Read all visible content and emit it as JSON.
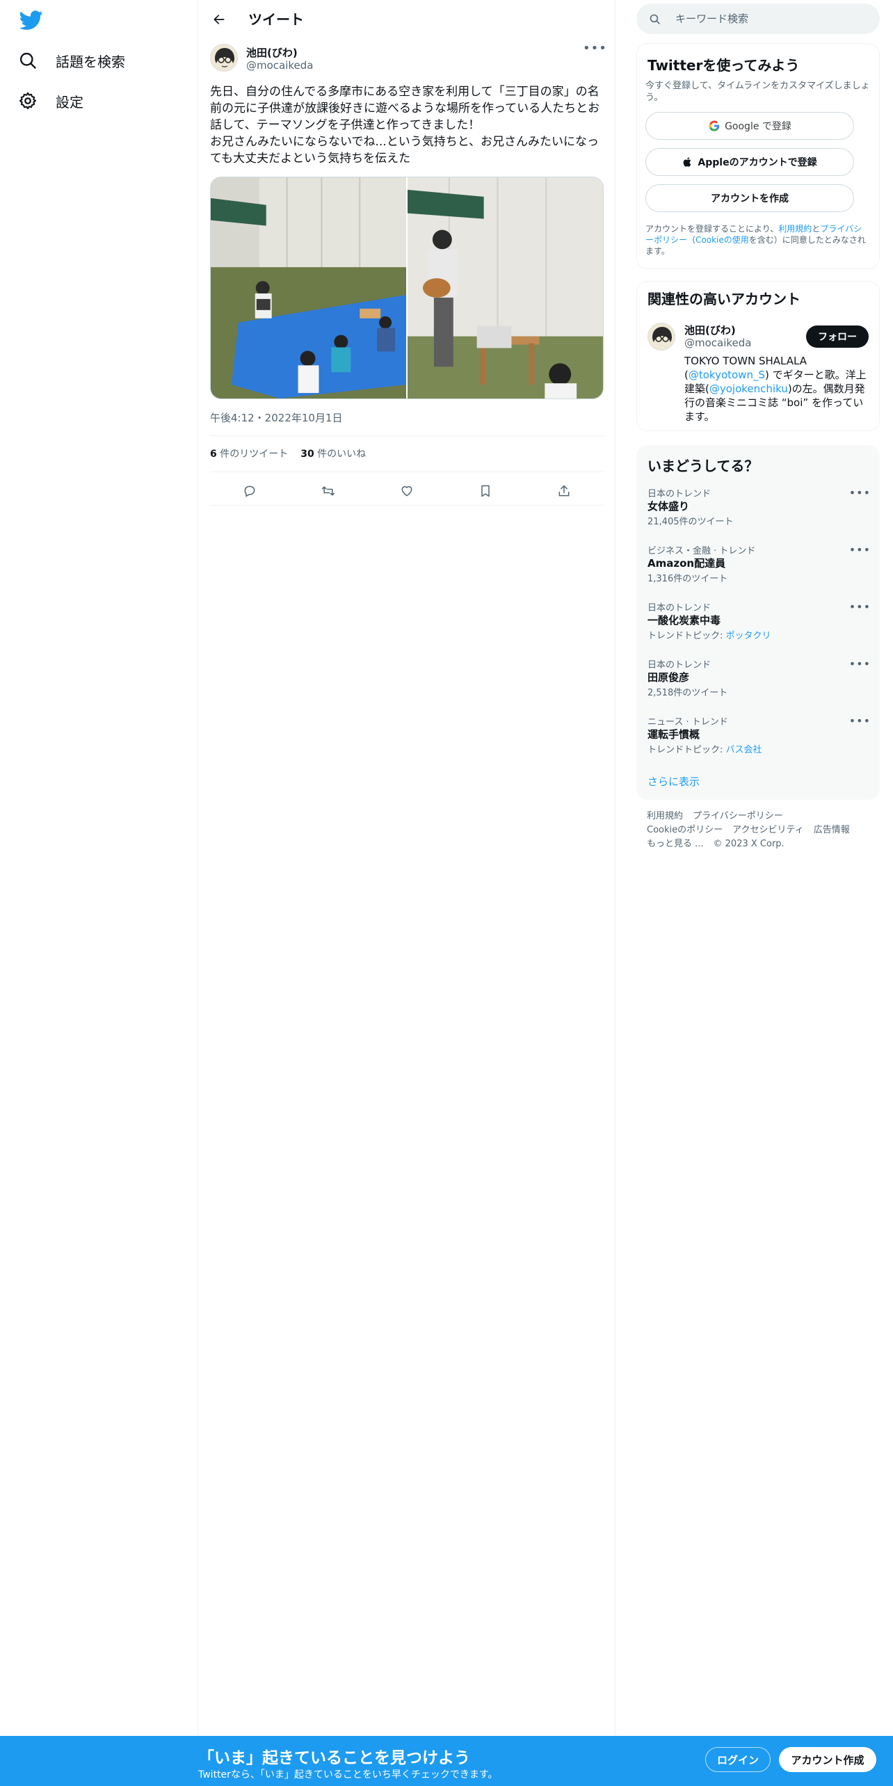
{
  "colors": {
    "accent": "#1d9bf0",
    "text": "#0f1419",
    "muted": "#536471",
    "border": "#eff3f4"
  },
  "nav": {
    "logo_icon": "twitter-bird-icon",
    "items": [
      {
        "label": "話題を検索",
        "icon": "search-icon"
      },
      {
        "label": "設定",
        "icon": "gear-icon"
      }
    ]
  },
  "header": {
    "title": "ツイート"
  },
  "tweet": {
    "author_name": "池田(びわ)",
    "author_handle": "@mocaikeda",
    "text": "先日、自分の住んでる多摩市にある空き家を利用して「三丁目の家」の名前の元に子供達が放課後好きに遊べるような場所を作っている人たちとお話して、テーマソングを子供達と作ってきました！\nお兄さんみたいにならないでね...という気持ちと、お兄さんみたいになっても大丈夫だよという気持ちを伝えた",
    "timestamp": "午後4:12・2022年10月1日",
    "retweets_count": "6",
    "retweets_label": "件のリツイート",
    "likes_count": "30",
    "likes_label": "件のいいね"
  },
  "search": {
    "placeholder": "キーワード検索"
  },
  "signup": {
    "title": "Twitterを使ってみよう",
    "subtitle": "今すぐ登録して、タイムラインをカスタマイズしましょう。",
    "google_label": "Google で登録",
    "apple_label": "Appleのアカウントで登録",
    "create_label": "アカウントを作成",
    "legal_prefix": "アカウントを登録することにより、",
    "legal_terms": "利用規約",
    "legal_and": "と",
    "legal_privacy": "プライバシーポリシー",
    "legal_paren_open": "（",
    "legal_cookie": "Cookieの使用",
    "legal_suffix": "を含む）に同意したとみなされます。"
  },
  "related": {
    "title": "関連性の高いアカウント",
    "name": "池田(びわ)",
    "handle": "@mocaikeda",
    "follow_label": "フォロー",
    "bio_1": "TOKYO TOWN SHALALA (",
    "bio_link_1": "@tokyotown_S",
    "bio_2": ") でギターと歌。洋上建築(",
    "bio_link_2": "@yojokenchiku",
    "bio_3": ")の左。偶数月発行の音楽ミニコミ誌 “boi” を作っています。"
  },
  "trends": {
    "title": "いまどうしてる？",
    "items": [
      {
        "meta": "日本のトレンド",
        "name": "女体盛り",
        "sub": "21,405件のツイート",
        "sub_link": ""
      },
      {
        "meta": "ビジネス・金融 · トレンド",
        "name": "Amazon配達員",
        "sub": "1,316件のツイート",
        "sub_link": ""
      },
      {
        "meta": "日本のトレンド",
        "name": "一酸化炭素中毒",
        "sub": "トレンドトピック: ",
        "sub_link": "ポッタクリ"
      },
      {
        "meta": "日本のトレンド",
        "name": "田原俊彦",
        "sub": "2,518件のツイート",
        "sub_link": ""
      },
      {
        "meta": "ニュース · トレンド",
        "name": "運転手慣概",
        "sub": "トレンドトピック: ",
        "sub_link": "バス会社"
      }
    ],
    "show_more": "さらに表示"
  },
  "footer": {
    "terms": "利用規約",
    "privacy": "プライバシーポリシー",
    "cookie": "Cookieのポリシー",
    "accessibility": "アクセシビリティ",
    "ads": "広告情報",
    "more": "もっと見る ...",
    "copyright": "© 2023 X Corp."
  },
  "banner": {
    "title": "「いま」起きていることを見つけよう",
    "subtitle": "Twitterなら、「いま」起きていることをいち早くチェックできます。",
    "login_label": "ログイン",
    "create_label": "アカウント作成"
  }
}
